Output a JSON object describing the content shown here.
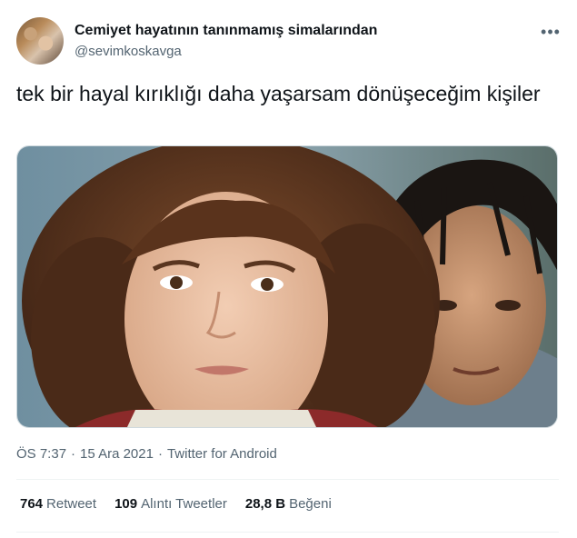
{
  "author": {
    "display_name": "Cemiyet hayatının tanınmamış simalarından",
    "handle": "@sevimkoskavga"
  },
  "more_icon": "more-horizontal-icon",
  "tweet": {
    "text": "tek bir hayal kırıklığı daha yaşarsam dönüşeceğim kişiler"
  },
  "meta": {
    "time": "ÖS 7:37",
    "date": "15 Ara 2021",
    "separator": "·",
    "source": "Twitter for Android"
  },
  "stats": {
    "retweets": {
      "count": "764",
      "label": "Retweet"
    },
    "quotes": {
      "count": "109",
      "label": "Alıntı Tweetler"
    },
    "likes": {
      "count": "28,8 B",
      "label": "Beğeni"
    }
  },
  "colors": {
    "text_primary": "#0f1419",
    "text_secondary": "#536471",
    "border": "#cfd9de",
    "divider": "#eff3f4"
  }
}
